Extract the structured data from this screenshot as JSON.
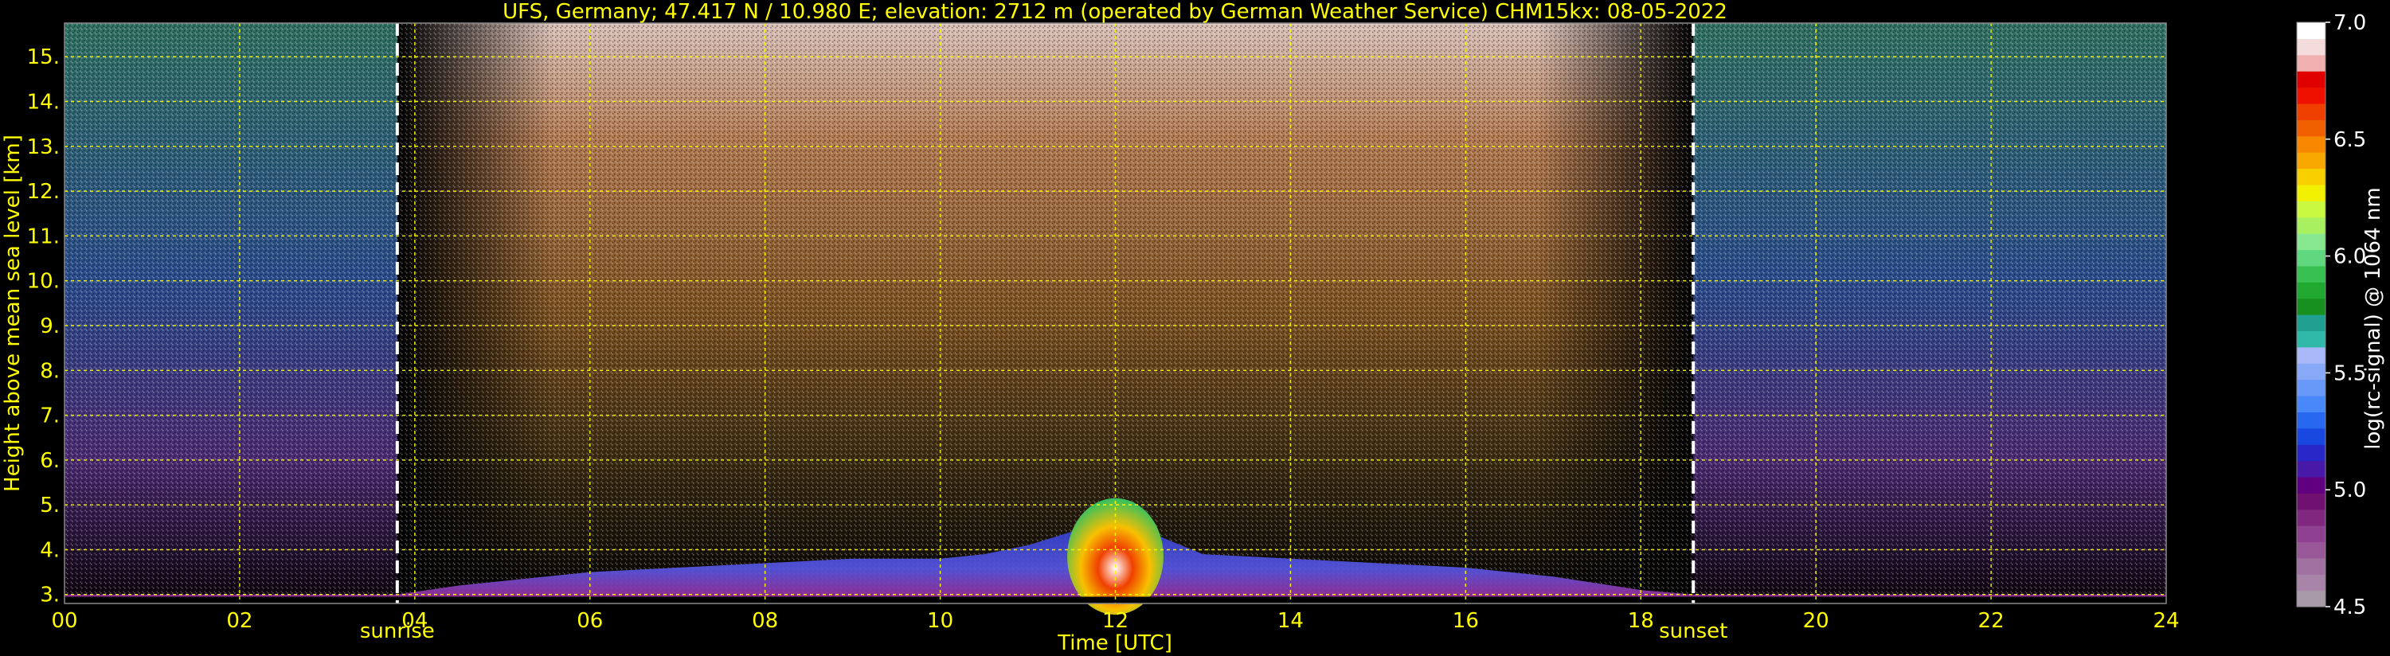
{
  "chart_data": {
    "type": "heatmap",
    "title": "UFS, Germany; 47.417 N / 10.980 E; elevation: 2712 m  (operated by German Weather Service)    CHM15kx: 08-05-2022",
    "xlabel": "Time [UTC]",
    "ylabel": "Height above mean sea level [km]",
    "xlim": [
      0,
      24
    ],
    "ylim": [
      2.8,
      15.75
    ],
    "x_ticks": [
      "00",
      "02",
      "04",
      "06",
      "08",
      "10",
      "12",
      "14",
      "16",
      "18",
      "20",
      "22",
      "24"
    ],
    "y_ticks": [
      "3.",
      "4.",
      "5.",
      "6.",
      "7.",
      "8.",
      "9.",
      "10.",
      "11.",
      "12.",
      "13.",
      "14.",
      "15."
    ],
    "grid": true,
    "grid_color": "#ffff00",
    "annotations": [
      {
        "label": "sunrise",
        "x": 3.8
      },
      {
        "label": "sunset",
        "x": 18.6
      }
    ],
    "colorbar": {
      "label": "log(rc-signal) @ 1064 nm",
      "range": [
        4.5,
        7.0
      ],
      "ticks": [
        "4.5",
        "5.0",
        "5.5",
        "6.0",
        "6.5",
        "7.0"
      ],
      "colors": [
        "#a89aa8",
        "#a884a8",
        "#a070a0",
        "#985898",
        "#904090",
        "#802880",
        "#701070",
        "#600080",
        "#4818a8",
        "#2828c8",
        "#1848e0",
        "#2868f0",
        "#4888f8",
        "#6898f8",
        "#88a8f8",
        "#a8b8f8",
        "#30b8a8",
        "#20a090",
        "#189020",
        "#20a830",
        "#38c050",
        "#60d880",
        "#88e890",
        "#a8f060",
        "#c8f840",
        "#f0f000",
        "#f8d000",
        "#f8a800",
        "#f88800",
        "#f06000",
        "#f04000",
        "#f01000",
        "#e00000",
        "#f0b0b0",
        "#f4dcdc",
        "#ffffff"
      ]
    },
    "series": [
      {
        "x": [
          0,
          1,
          2,
          3,
          3.8,
          4.5,
          5,
          6,
          7,
          8,
          9,
          10,
          10.5,
          11,
          11.5,
          12,
          12.5,
          13,
          14,
          15,
          16,
          17,
          18,
          18.6,
          19,
          20,
          21,
          22,
          23,
          24
        ],
        "y": [
          3.0,
          3.0,
          3.0,
          3.0,
          3.0,
          3.2,
          3.3,
          3.5,
          3.6,
          3.7,
          3.8,
          3.8,
          3.9,
          4.1,
          4.4,
          4.5,
          4.3,
          3.9,
          3.8,
          3.7,
          3.6,
          3.4,
          3.1,
          3.0,
          3.0,
          3.0,
          3.0,
          3.0,
          3.0,
          3.0
        ]
      }
    ]
  }
}
